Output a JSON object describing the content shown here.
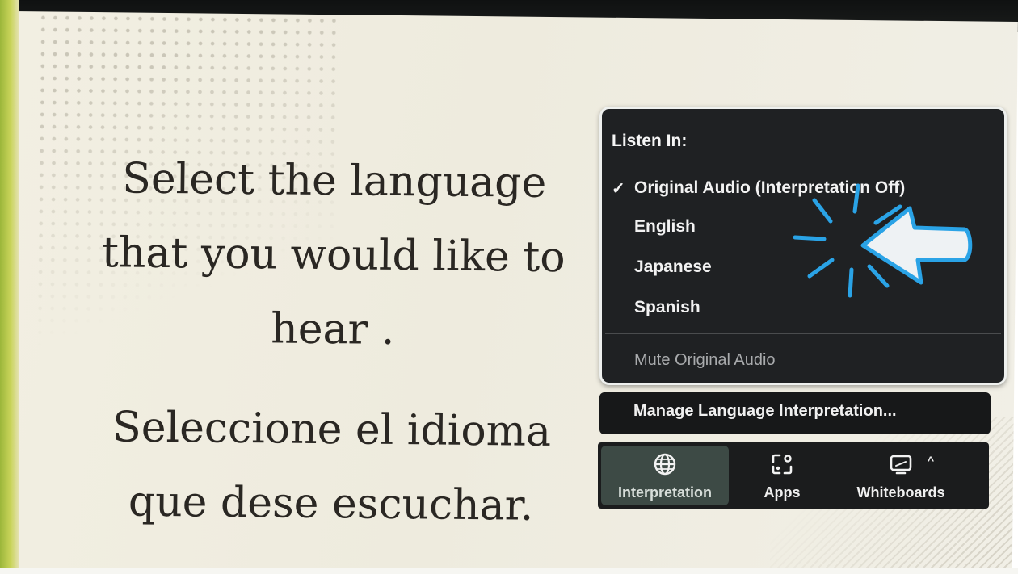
{
  "slide": {
    "english_lines": [
      "Select the language",
      "that you would like to",
      "hear ."
    ],
    "spanish_lines": [
      "Seleccione el idioma",
      "que dese escuchar."
    ]
  },
  "popup": {
    "title": "Listen In:",
    "selected_mark": "✓",
    "items": [
      {
        "label": "Original Audio (Interpretation Off)",
        "selected": true
      },
      {
        "label": "English",
        "selected": false
      },
      {
        "label": "Japanese",
        "selected": false
      },
      {
        "label": "Spanish",
        "selected": false
      }
    ],
    "mute_label": "Mute Original Audio"
  },
  "manage": {
    "label": "Manage Language Interpretation..."
  },
  "toolbar": {
    "buttons": [
      {
        "label": "Interpretation",
        "icon": "globe-icon"
      },
      {
        "label": "Apps",
        "icon": "apps-icon"
      },
      {
        "label": "Whiteboards",
        "icon": "whiteboard-icon"
      }
    ],
    "caret": "^"
  },
  "colors": {
    "popup_bg": "#1f2123",
    "toolbar_bg": "#1b1c1d",
    "active_button": "#3d4a45",
    "pointer_accent": "#2aa3e6",
    "slide_bg": "#f0ede0"
  }
}
